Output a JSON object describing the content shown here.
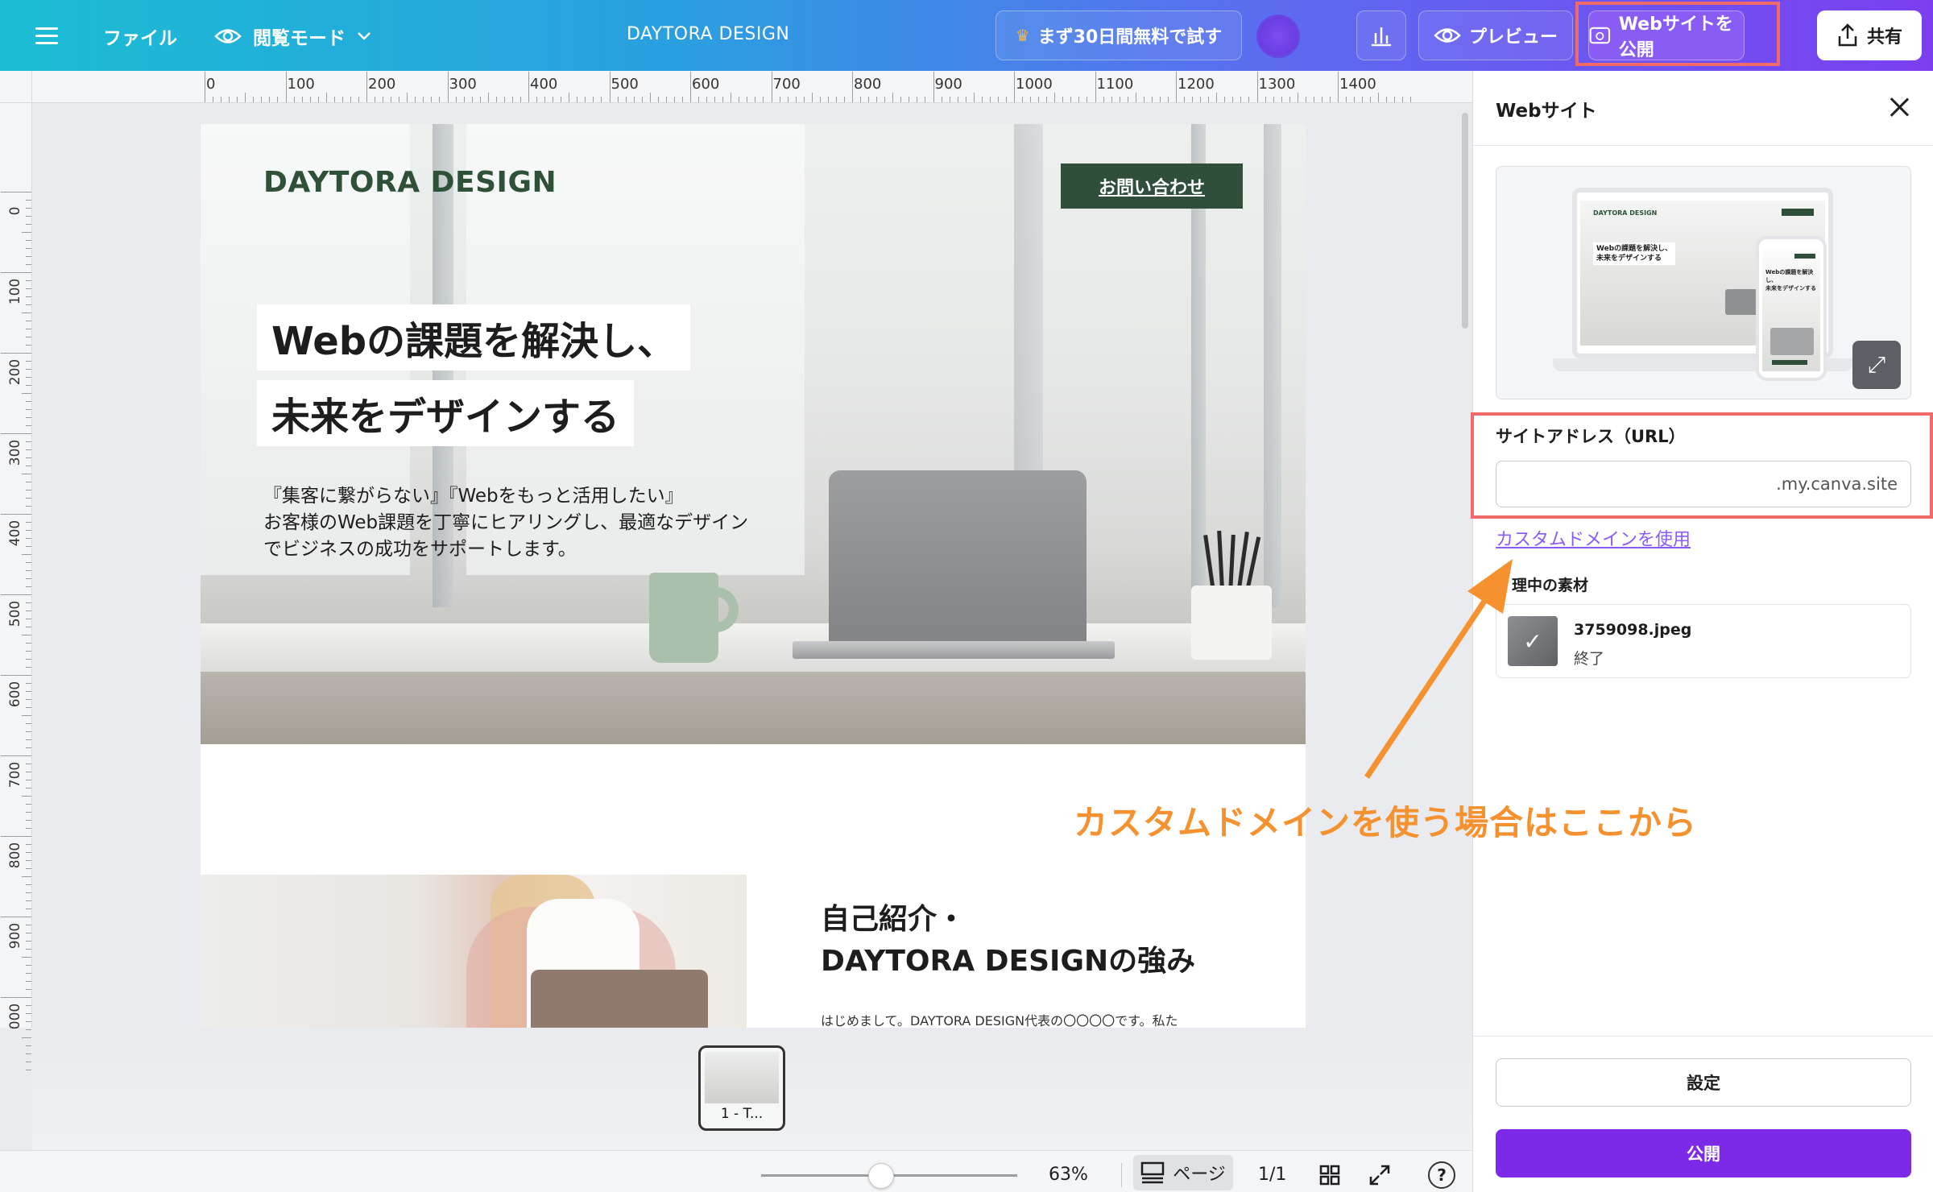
{
  "topbar": {
    "file_label": "ファイル",
    "view_mode_label": "閲覧モード",
    "doc_title": "DAYTORA DESIGN",
    "trial_label": "まず30日間無料で試す",
    "preview_label": "プレビュー",
    "publish_label": "Webサイトを公開",
    "share_label": "共有"
  },
  "ruler": {
    "top": [
      "0",
      "100",
      "200",
      "300",
      "400",
      "500",
      "600",
      "700",
      "800",
      "900",
      "1000",
      "1100",
      "1200",
      "1300",
      "1400"
    ],
    "left": [
      "0",
      "100",
      "200",
      "300",
      "400",
      "500",
      "600",
      "700",
      "800",
      "900",
      "000"
    ]
  },
  "design": {
    "brand": "DAYTORA DESIGN",
    "contact": "お問い合わせ",
    "headline1": "Webの課題を解決し、",
    "headline2": "未来をデザインする",
    "desc": "『集客に繋がらない』『Webをもっと活用したい』\nお客様のWeb課題を丁寧にヒアリングし、最適なデザイン\nでビジネスの成功をサポートします。",
    "about_title": "自己紹介・\nDAYTORA DESIGNの強み",
    "about_text": "はじめまして。DAYTORA DESIGN代表の〇〇〇〇です。私た"
  },
  "bottom": {
    "thumb_label": "1 - T...",
    "zoom": "63%",
    "page_label": "ページ",
    "page_count": "1/1",
    "zoom_level": 0.47
  },
  "panel": {
    "title": "Webサイト",
    "preview_brand": "DAYTORA DESIGN",
    "preview_heading": "Webの課題を解決し、\n未来をデザインする",
    "phone_heading": "Webの課題を解決し、\n未来をデザインする",
    "address_label": "サイトアドレス（URL）",
    "address_suffix": ".my.canva.site",
    "custom_domain_link": "カスタムドメインを使用",
    "processing_label": "理中の素材",
    "file_name": "3759098.jpeg",
    "file_status": "終了",
    "settings_label": "設定",
    "publish_label": "公開"
  },
  "annotation": {
    "text": "カスタムドメインを使う場合はここから",
    "color": "#f5922f",
    "highlight_color": "#f06a6a"
  },
  "colors": {
    "accent": "#7d2ae8",
    "brand_green": "#2f4f3a"
  }
}
